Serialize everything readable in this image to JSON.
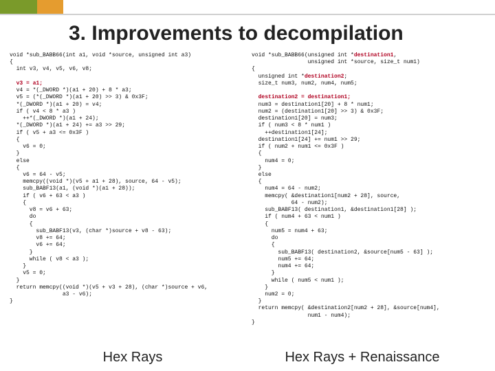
{
  "title": "3. Improvements to decompilation",
  "cap_left": "Hex Rays",
  "cap_right": "Hex Rays + Renaissance",
  "left": {
    "l01": "void *sub_BABB66(int a1, void *source, unsigned int a3)",
    "l02": "{",
    "l03": "  int v3, v4, v5, v6, v8;",
    "l04": "",
    "l05a": "  ",
    "l05b": "v3 = a1;",
    "l06": "  v4 = *(_DWORD *)(a1 + 20) + 8 * a3;",
    "l07": "  v5 = (*(_DWORD *)(a1 + 20) >> 3) & 0x3F;",
    "l08": "  *(_DWORD *)(a1 + 20) = v4;",
    "l09": "  if ( v4 < 8 * a3 )",
    "l10": "    ++*(_DWORD *)(a1 + 24);",
    "l11": "  *(_DWORD *)(a1 + 24) += a3 >> 29;",
    "l12": "  if ( v5 + a3 <= 0x3F )",
    "l13": "  {",
    "l14": "    v6 = 0;",
    "l15": "  }",
    "l16": "  else",
    "l17": "  {",
    "l18": "    v6 = 64 - v5;",
    "l19": "    memcpy((void *)(v5 + a1 + 28), source, 64 - v5);",
    "l20": "    sub_BABF13(a1, (void *)(a1 + 28));",
    "l21": "    if ( v6 + 63 < a3 )",
    "l22": "    {",
    "l23": "      v8 = v6 + 63;",
    "l24": "      do",
    "l25": "      {",
    "l26": "        sub_BABF13(v3, (char *)source + v8 - 63);",
    "l27": "        v8 += 64;",
    "l28": "        v6 += 64;",
    "l29": "      }",
    "l30": "      while ( v8 < a3 );",
    "l31": "    }",
    "l32": "    v5 = 0;",
    "l33": "  }",
    "l34": "  return memcpy((void *)(v5 + v3 + 28), (char *)source + v6,",
    "l35": "                a3 - v6);",
    "l36": "}"
  },
  "right": {
    "r01": "void *sub_BABB66(unsigned int *",
    "r01b": "destination1",
    "r01c": ",",
    "r02": "                 unsigned int *source, size_t num1)",
    "r03": "{",
    "r04": "  unsigned int *",
    "r04b": "destination2",
    "r04c": ";",
    "r05": "  size_t num3, num2, num4, num5;",
    "r06": "",
    "r07a": "  ",
    "r07b": "destination2 = destination1;",
    "r08": "  num3 = destination1[20] + 8 * num1;",
    "r09": "  num2 = (destination1[20] >> 3) & 0x3F;",
    "r10": "  destination1[20] = num3;",
    "r11": "  if ( num3 < 8 * num1 )",
    "r12": "    ++destination1[24];",
    "r13": "  destination1[24] += num1 >> 29;",
    "r14": "  if ( num2 + num1 <= 0x3F )",
    "r15": "  {",
    "r16": "    num4 = 0;",
    "r17": "  }",
    "r18": "  else",
    "r19": "  {",
    "r20": "    num4 = 64 - num2;",
    "r21": "    memcpy( &destination1[num2 + 28], source,",
    "r22": "            64 - num2);",
    "r23": "    sub_BABF13( destination1, &destination1[28] );",
    "r24": "    if ( num4 + 63 < num1 )",
    "r25": "    {",
    "r26": "      num5 = num4 + 63;",
    "r27": "      do",
    "r28": "      {",
    "r29": "        sub_BABF13( destination2, &source[num5 - 63] );",
    "r30": "        num5 += 64;",
    "r31": "        num4 += 64;",
    "r32": "      }",
    "r33": "      while ( num5 < num1 );",
    "r34": "    }",
    "r35": "    num2 = 0;",
    "r36": "  }",
    "r37": "  return memcpy( &destination2[num2 + 28], &source[num4],",
    "r38": "                 num1 - num4);",
    "r39": "}"
  }
}
